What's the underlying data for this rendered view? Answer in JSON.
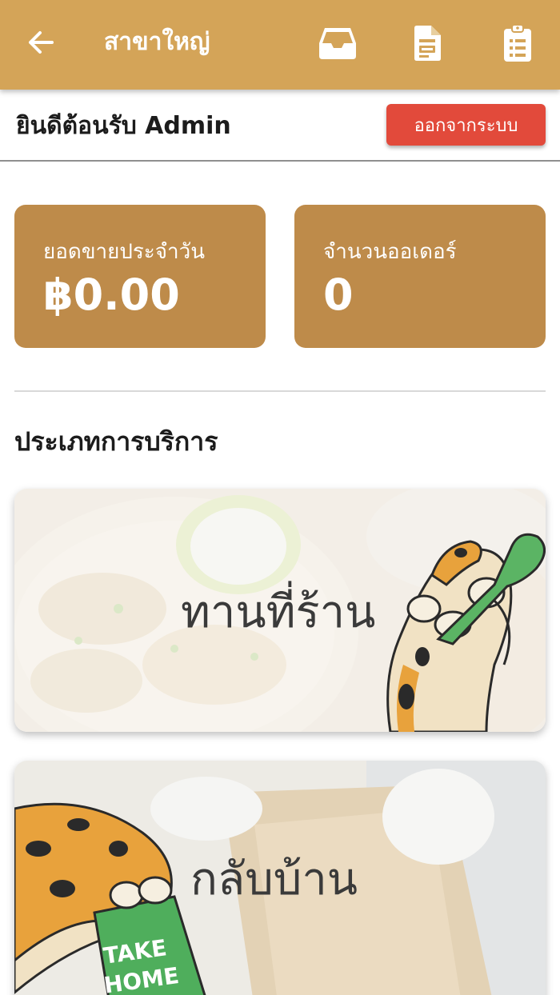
{
  "header": {
    "title": "สาขาใหญ่",
    "back_icon": "arrow-left-icon",
    "icons": [
      "inbox-tray-icon",
      "document-icon",
      "clipboard-list-icon"
    ],
    "background_color": "#d4a458"
  },
  "welcome": {
    "text": "ยินดีต้อนรับ Admin",
    "logout_label": "ออกจากระบบ",
    "logout_color": "#e24a3b"
  },
  "stats": {
    "sales_label": "ยอดขายประจำวัน",
    "sales_value": "฿0.00",
    "orders_label": "จำนวนออเดอร์",
    "orders_value": "0",
    "card_color": "#be8b4a"
  },
  "services": {
    "title": "ประเภทการบริการ",
    "dine_in_label": "ทานที่ร้าน",
    "take_home_label": "กลับบ้าน",
    "bag_line1": "TAKE",
    "bag_line2": "HOME"
  }
}
